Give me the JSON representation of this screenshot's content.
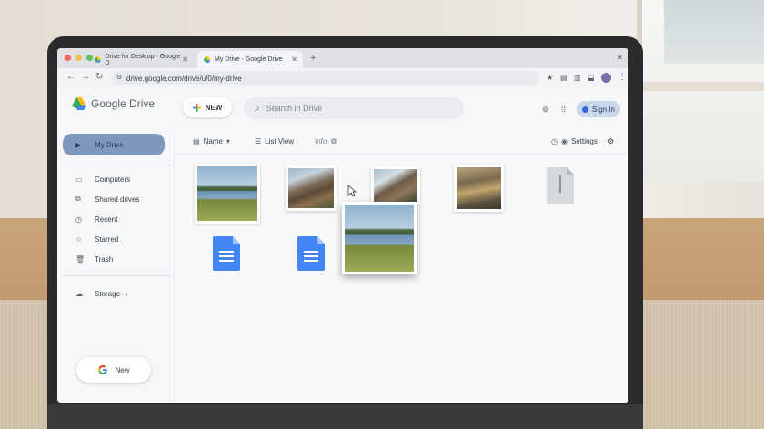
{
  "browser": {
    "tabs": [
      {
        "label": "Drive for Desktop - Google D",
        "active": false
      },
      {
        "label": "My Drive - Google Drive",
        "active": true
      }
    ],
    "new_tab": "+",
    "url": "drive.google.com/drive/u/0/my-drive"
  },
  "header": {
    "logo_text": "Google Drive",
    "new_button": "NEW",
    "search_placeholder": "Search in Drive",
    "signin": "Sign In"
  },
  "sidebar": {
    "items": [
      {
        "label": "My Drive",
        "icon": "drive-icon",
        "active": true
      },
      {
        "label": "Computers",
        "icon": "computer-icon"
      },
      {
        "label": "Shared drives",
        "icon": "shared-drives-icon"
      },
      {
        "label": "Recent",
        "icon": "clock-icon"
      },
      {
        "label": "Starred",
        "icon": "star-icon"
      },
      {
        "label": "Trash",
        "icon": "trash-icon"
      },
      {
        "label": "Storage",
        "icon": "cloud-icon"
      }
    ],
    "storage_chevron": "›",
    "new_button": "New"
  },
  "main_toolbar": {
    "sort": "Name",
    "view": "List View",
    "info": "Info",
    "settings": "Settings"
  },
  "files": [
    {
      "type": "image",
      "icon": "landscape-lake"
    },
    {
      "type": "image",
      "icon": "landscape-mountain"
    },
    {
      "type": "image",
      "icon": "landscape-mountain"
    },
    {
      "type": "image",
      "icon": "landscape-valley"
    },
    {
      "type": "zip",
      "icon": "zip-file-icon"
    },
    {
      "type": "doc",
      "icon": "google-docs-icon"
    },
    {
      "type": "doc",
      "icon": "google-docs-icon"
    },
    {
      "type": "image-dragging",
      "icon": "landscape-lake"
    }
  ],
  "colors": {
    "active_nav": "#7f97bc",
    "docs_blue": "#4285f4",
    "signin_bg": "#c9d7e8"
  }
}
